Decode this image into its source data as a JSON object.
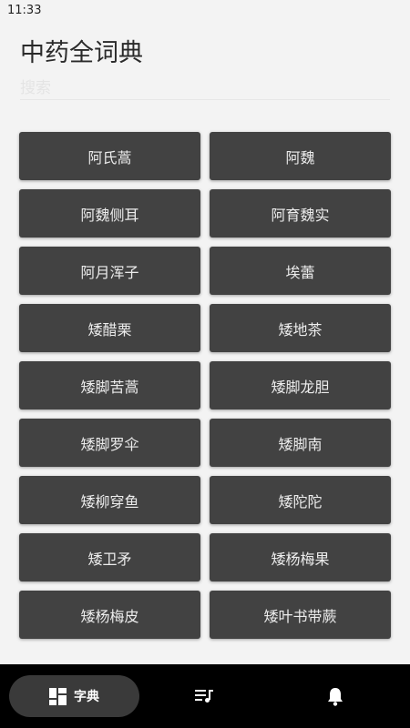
{
  "status_bar": {
    "time": "11:33"
  },
  "header": {
    "title": "中药全词典"
  },
  "search": {
    "placeholder": "搜索"
  },
  "herbs": [
    "阿氏蒿",
    "阿魏",
    "阿魏侧耳",
    "阿育魏实",
    "阿月浑子",
    "埃蕾",
    "矮醋栗",
    "矮地茶",
    "矮脚苦蒿",
    "矮脚龙胆",
    "矮脚罗伞",
    "矮脚南",
    "矮柳穿鱼",
    "矮陀陀",
    "矮卫矛",
    "矮杨梅果",
    "矮杨梅皮",
    "矮叶书带蕨"
  ],
  "bottom_nav": {
    "items": [
      {
        "label": "字典",
        "icon": "dashboard-icon",
        "active": true
      },
      {
        "label": "",
        "icon": "playlist-icon",
        "active": false
      },
      {
        "label": "",
        "icon": "bell-icon",
        "active": false
      }
    ]
  },
  "colors": {
    "background": "#f3f3f3",
    "button": "#424242",
    "nav_bar": "#000000",
    "nav_active": "#3a3a3a"
  }
}
